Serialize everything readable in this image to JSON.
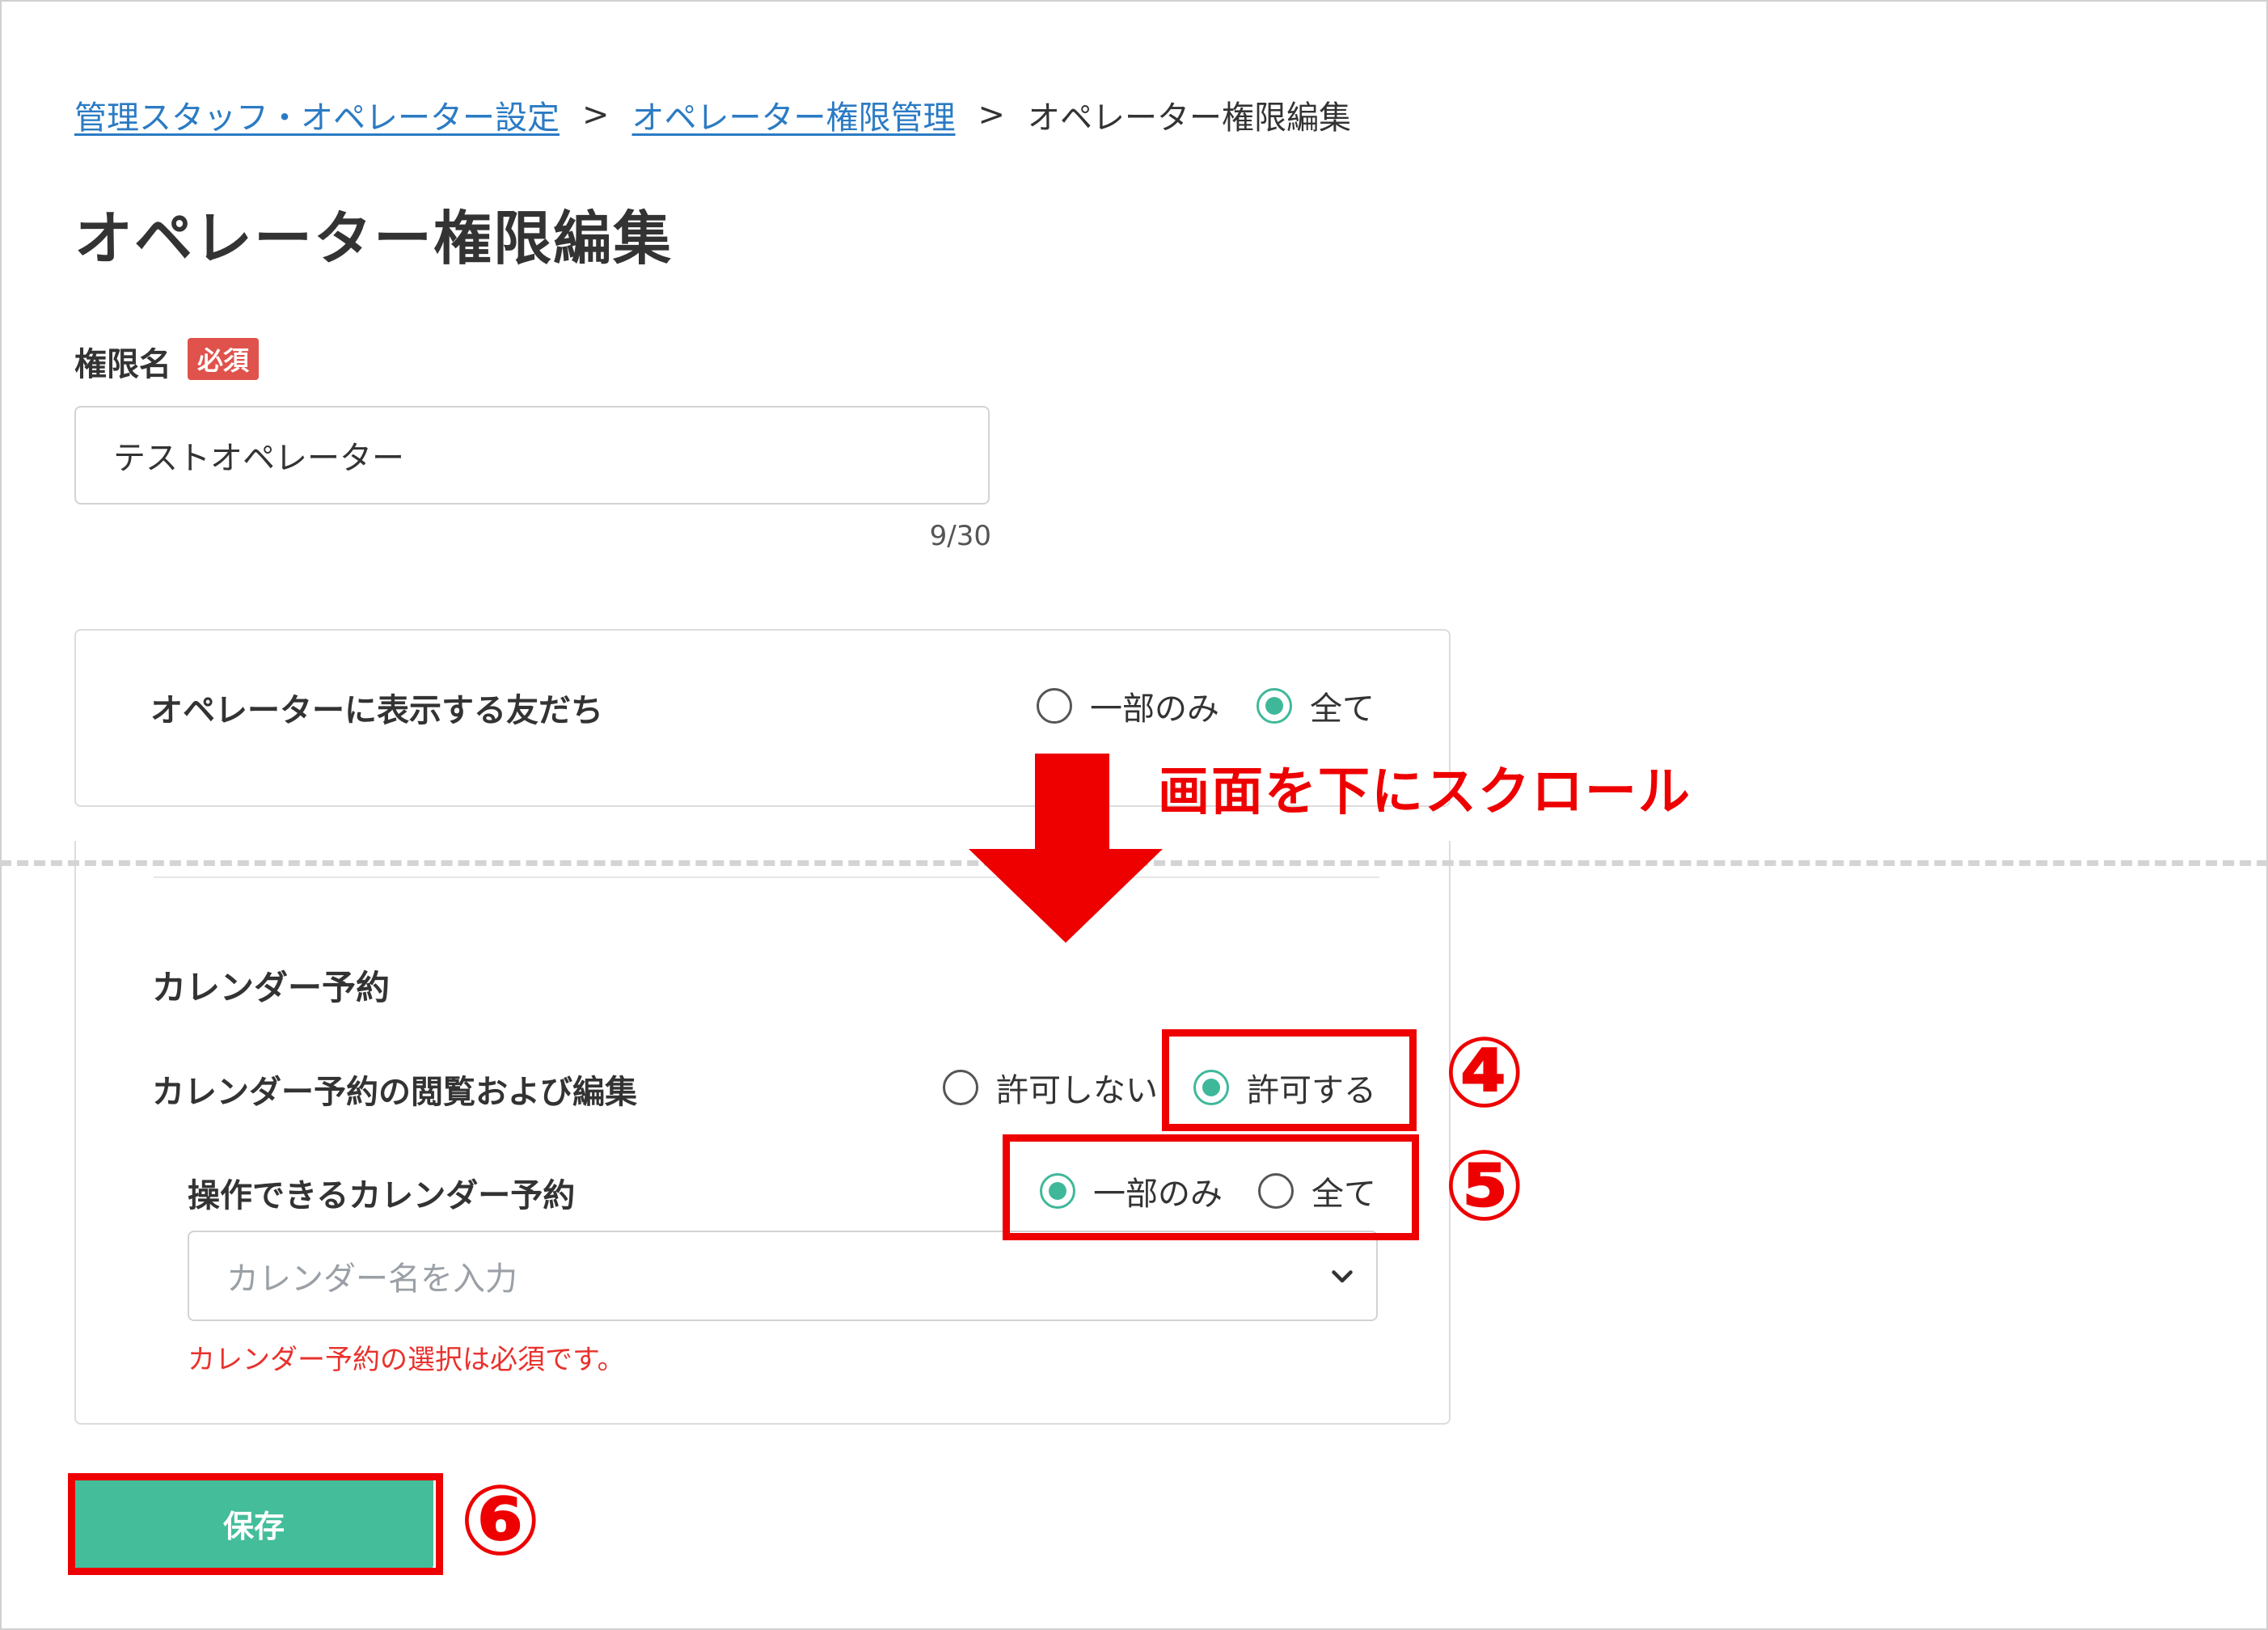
{
  "breadcrumb": {
    "items": [
      "管理スタッフ・オペレーター設定",
      "オペレーター権限管理"
    ],
    "separator": ">",
    "current": "オペレーター権限編集"
  },
  "page_title": "オペレーター権限編集",
  "permission_name": {
    "label": "権限名",
    "required_badge": "必須",
    "value": "テストオペレーター",
    "char_count": "9/30"
  },
  "friends_visibility": {
    "label": "オペレーターに表示する友だち",
    "options": [
      "一部のみ",
      "全て"
    ],
    "selected": "全て"
  },
  "annotation": {
    "scroll_text": "画面を下にスクロール",
    "step4": "④",
    "step5": "⑤",
    "step6": "⑥",
    "color": "#ee0000"
  },
  "calendar_reservation": {
    "section_title": "カレンダー予約",
    "view_edit_label": "カレンダー予約の閲覧および編集",
    "view_edit_options": [
      "許可しない",
      "許可する"
    ],
    "view_edit_selected": "許可する",
    "operable_label": "操作できるカレンダー予約",
    "operable_options": [
      "一部のみ",
      "全て"
    ],
    "operable_selected": "一部のみ",
    "select_placeholder": "カレンダー名を入力",
    "error_message": "カレンダー予約の選択は必須です。"
  },
  "save_button": "保存",
  "colors": {
    "link": "#2b7bc4",
    "accent": "#44bd9b",
    "error": "#e8322d",
    "badge": "#e0524c"
  }
}
